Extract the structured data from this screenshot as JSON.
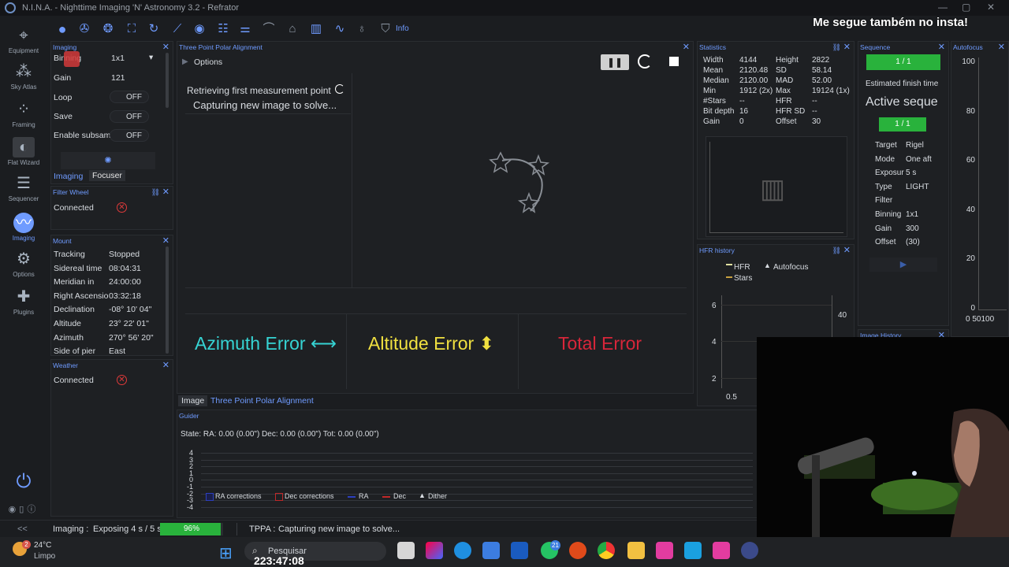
{
  "window": {
    "title": "N.I.N.A. - Nighttime Imaging 'N' Astronomy 3.2   -   Refrator",
    "promo": "Me segue também no insta!"
  },
  "nav": [
    {
      "label": "Equipment"
    },
    {
      "label": "Sky Atlas"
    },
    {
      "label": "Framing"
    },
    {
      "label": "Flat Wizard"
    },
    {
      "label": "Sequencer"
    },
    {
      "label": "Imaging"
    },
    {
      "label": "Options"
    },
    {
      "label": "Plugins"
    }
  ],
  "toolbar": {
    "info_label": "Info"
  },
  "imaging_panel": {
    "title": "Imaging",
    "binning_label": "Binning",
    "binning_value": "1x1",
    "gain_label": "Gain",
    "gain_value": "121",
    "loop_label": "Loop",
    "loop_value": "OFF",
    "save_label": "Save",
    "save_value": "OFF",
    "subsample_label": "Enable subsam",
    "subsample_value": "OFF",
    "tab_imaging": "Imaging",
    "tab_focuser": "Focuser"
  },
  "filter_wheel": {
    "title": "Filter Wheel",
    "connected_label": "Connected"
  },
  "mount": {
    "title": "Mount",
    "rows": [
      {
        "label": "Tracking",
        "value": "Stopped"
      },
      {
        "label": "Sidereal time",
        "value": "08:04:31"
      },
      {
        "label": "Meridian in",
        "value": "24:00:00"
      },
      {
        "label": "Right Ascensio",
        "value": "03:32:18"
      },
      {
        "label": "Declination",
        "value": "-08° 10' 04\""
      },
      {
        "label": "Altitude",
        "value": "23° 22' 01\""
      },
      {
        "label": "Azimuth",
        "value": "270° 56' 20\""
      },
      {
        "label": "Side of pier",
        "value": "East"
      }
    ]
  },
  "weather": {
    "title": "Weather",
    "connected_label": "Connected"
  },
  "tpa": {
    "title": "Three Point Polar Alignment",
    "options_label": "Options",
    "status_line1": "Retrieving first measurement point",
    "status_line2": "Capturing new image to solve...",
    "azimuth_label": "Azimuth Error",
    "altitude_label": "Altitude Error",
    "total_label": "Total Error",
    "tab_image": "Image",
    "tab_tpa": "Three Point Polar Alignment"
  },
  "guider": {
    "title": "Guider",
    "state": "State:  RA: 0.00 (0.00\")  Dec: 0.00 (0.00\")  Tot: 0.00 (0.00\")",
    "yticks": [
      "4",
      "3",
      "2",
      "1",
      "0",
      "-1",
      "-2",
      "-3",
      "-4"
    ],
    "legend": [
      "RA corrections",
      "Dec corrections",
      "RA",
      "Dec",
      "Dither"
    ],
    "colors": {
      "ra": "#2c3fbf",
      "dec": "#c02828"
    }
  },
  "statistics": {
    "title": "Statistics",
    "left": [
      {
        "label": "Width",
        "value": "4144"
      },
      {
        "label": "Mean",
        "value": "2120.48"
      },
      {
        "label": "Median",
        "value": "2120.00"
      },
      {
        "label": "Min",
        "value": "1912 (2x)"
      },
      {
        "label": "#Stars",
        "value": "--"
      },
      {
        "label": "Bit depth",
        "value": "16"
      },
      {
        "label": "Gain",
        "value": "0"
      }
    ],
    "right": [
      {
        "label": "Height",
        "value": "2822"
      },
      {
        "label": "SD",
        "value": "58.14"
      },
      {
        "label": "MAD",
        "value": "52.00"
      },
      {
        "label": "Max",
        "value": "19124 (1x)"
      },
      {
        "label": "HFR",
        "value": "--"
      },
      {
        "label": "HFR SD",
        "value": "--"
      },
      {
        "label": "Offset",
        "value": "30"
      }
    ]
  },
  "hfr_history": {
    "title": "HFR history",
    "legend_hfr": "HFR",
    "legend_autofocus": "Autofocus",
    "legend_stars": "Stars",
    "y_left": [
      "6",
      "4",
      "2"
    ],
    "y_right": [
      "40"
    ],
    "x_first": "0.5"
  },
  "sequence": {
    "title": "Sequence",
    "progress1": "1 / 1",
    "est_finish": "Estimated finish time",
    "active": "Active seque",
    "progress2": "1 / 1",
    "rows": [
      {
        "label": "Target",
        "value": "Rigel"
      },
      {
        "label": "Mode",
        "value": "One aft"
      },
      {
        "label": "Exposur",
        "value": "5 s"
      },
      {
        "label": "Type",
        "value": "LIGHT"
      },
      {
        "label": "Filter",
        "value": ""
      },
      {
        "label": "Binning",
        "value": "1x1"
      },
      {
        "label": "Gain",
        "value": "300"
      },
      {
        "label": "Offset",
        "value": "(30)"
      }
    ]
  },
  "image_history": {
    "title": "Image History"
  },
  "autofocus": {
    "title": "Autofocus",
    "yticks": [
      "100",
      "80",
      "60",
      "40",
      "20",
      "0"
    ],
    "xlabel": "0 50100"
  },
  "statusbar": {
    "collapse": "<<",
    "imaging_label": "Imaging :",
    "imaging_text": "Exposing 4 s / 5 s",
    "progress_text": "96%",
    "progress_fraction": 0.96,
    "tppa_label": "TPPA :",
    "tppa_text": "Capturing new image to solve..."
  },
  "taskbar": {
    "weather_temp": "24°C",
    "weather_desc": "Limpo",
    "weather_badge": "2",
    "search_label": "Pesquisar",
    "clock": "223:47:08",
    "whatsapp_badge": "21"
  }
}
